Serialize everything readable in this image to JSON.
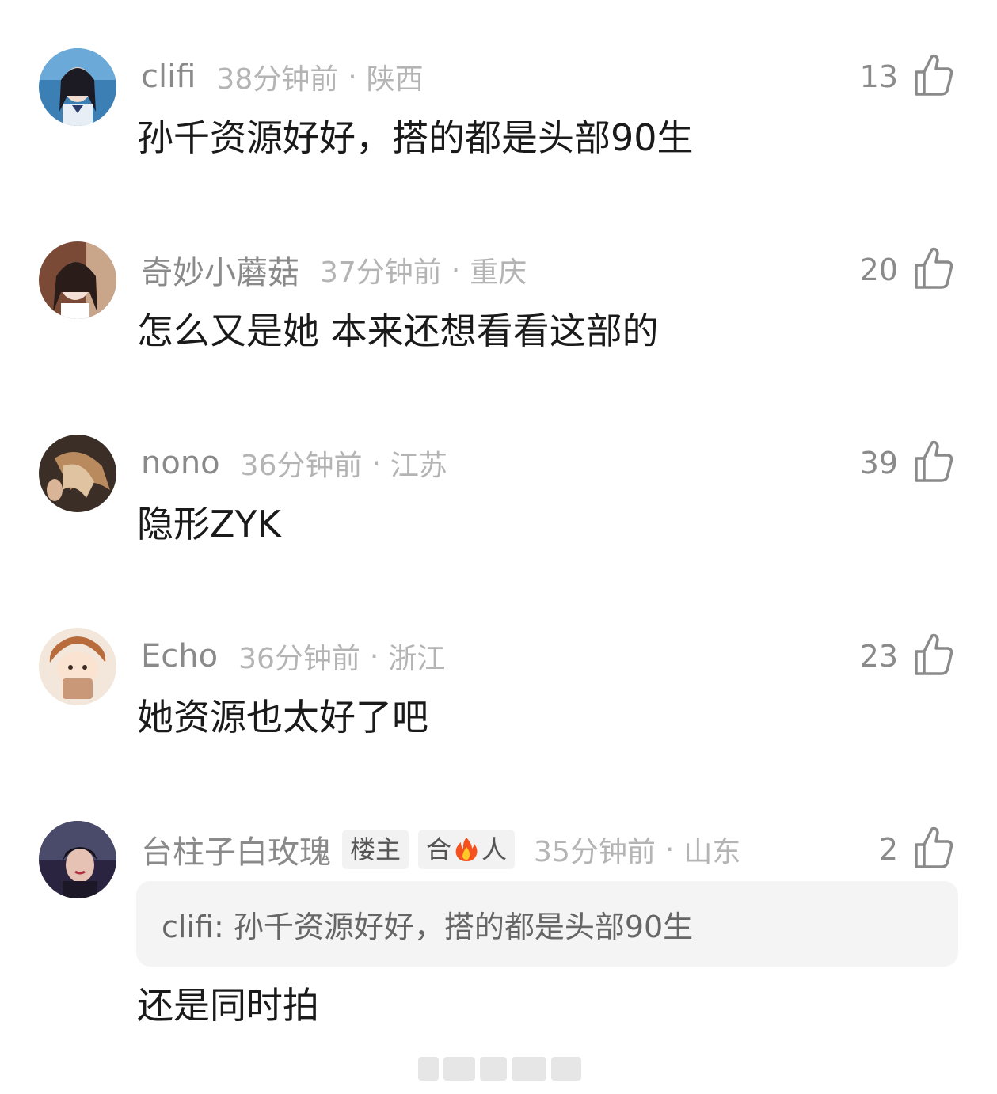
{
  "comments": [
    {
      "username": "clifi",
      "time": "38分钟前",
      "separator": "·",
      "region": "陕西",
      "likes": "13",
      "text": "孙千资源好好，搭的都是头部90生"
    },
    {
      "username": "奇妙小蘑菇",
      "time": "37分钟前",
      "separator": "·",
      "region": "重庆",
      "likes": "20",
      "text": "怎么又是她 本来还想看看这部的"
    },
    {
      "username": "nono",
      "time": "36分钟前",
      "separator": "·",
      "region": "江苏",
      "likes": "39",
      "text": "隐形ZYK"
    },
    {
      "username": "Echo",
      "time": "36分钟前",
      "separator": "·",
      "region": "浙江",
      "likes": "23",
      "text": "她资源也太好了吧"
    },
    {
      "username": "台柱子白玫瑰",
      "badge_owner": "楼主",
      "badge_fire_left": "合",
      "badge_fire_right": "人",
      "time": "35分钟前",
      "separator": "·",
      "region": "山东",
      "likes": "2",
      "quote": "clifi: 孙千资源好好，搭的都是头部90生",
      "text": "还是同时拍"
    }
  ],
  "colors": {
    "username": "#8a8a8a",
    "meta": "#b4b4b4",
    "content": "#1a1a1a",
    "quote_bg": "#f4f4f4"
  },
  "icons": {
    "like": "thumbs-up-icon",
    "fire": "fire-icon"
  }
}
